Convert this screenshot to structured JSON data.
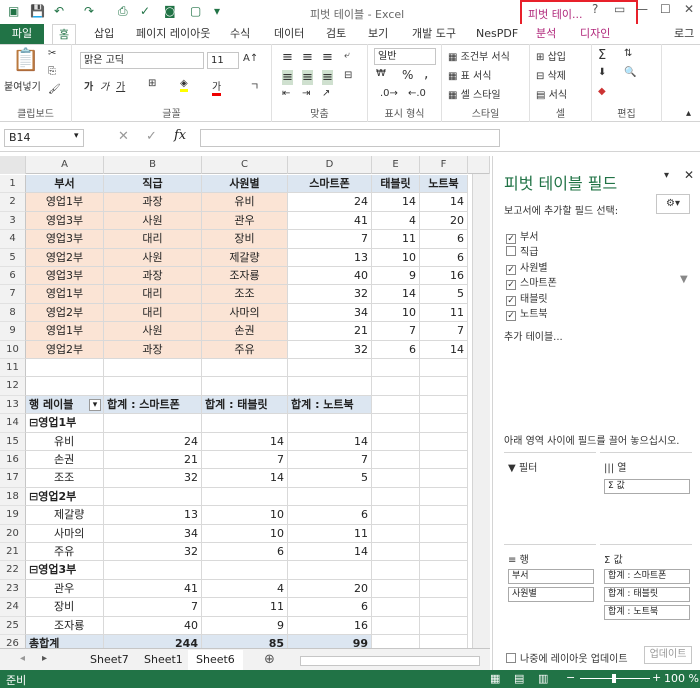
{
  "window": {
    "title": "피벗 테이블 - Excel",
    "context_group": "피벗 테이...",
    "help": "?"
  },
  "qat": {
    "save": "save-icon",
    "undo": "undo-icon",
    "redo": "redo-icon"
  },
  "tabs": {
    "file": "파일",
    "items": [
      "홈",
      "삽입",
      "페이지 레이아웃",
      "수식",
      "데이터",
      "검토",
      "보기",
      "개발 도구",
      "NesPDF"
    ],
    "context": [
      "분석",
      "디자인"
    ],
    "login": "로그"
  },
  "ribbon": {
    "clipboard": {
      "label": "클립보드",
      "paste": "붙여넣기"
    },
    "font": {
      "label": "글꼴",
      "name": "맑은 고딕",
      "size": "11"
    },
    "align": {
      "label": "맞춤"
    },
    "number": {
      "label": "표시 형식",
      "format": "일반",
      "percent": "%",
      "comma": ","
    },
    "styles": {
      "label": "스타일",
      "cond": "조건부 서식",
      "table": "표 서식",
      "cell": "셀 스타일"
    },
    "cells": {
      "label": "셀",
      "insert": "삽입",
      "delete": "삭제",
      "format": "서식"
    },
    "editing": {
      "label": "편집"
    }
  },
  "formula": {
    "namebox": "B14",
    "fx": "fx"
  },
  "columns": [
    "A",
    "B",
    "C",
    "D",
    "E",
    "F"
  ],
  "rows": [
    "1",
    "2",
    "3",
    "4",
    "5",
    "6",
    "7",
    "8",
    "9",
    "10",
    "11",
    "12",
    "13",
    "14",
    "15",
    "16",
    "17",
    "18",
    "19",
    "20",
    "21",
    "22",
    "23",
    "24",
    "25",
    "26"
  ],
  "table": {
    "headers": [
      "부서",
      "직급",
      "사원별",
      "스마트폰",
      "태블릿",
      "노트북"
    ],
    "data": [
      [
        "영업1부",
        "과장",
        "유비",
        "24",
        "14",
        "14"
      ],
      [
        "영업3부",
        "사원",
        "관우",
        "41",
        "4",
        "20"
      ],
      [
        "영업3부",
        "대리",
        "장비",
        "7",
        "11",
        "6"
      ],
      [
        "영업2부",
        "사원",
        "제갈량",
        "13",
        "10",
        "6"
      ],
      [
        "영업3부",
        "과장",
        "조자룡",
        "40",
        "9",
        "16"
      ],
      [
        "영업1부",
        "대리",
        "조조",
        "32",
        "14",
        "5"
      ],
      [
        "영업2부",
        "대리",
        "사마의",
        "34",
        "10",
        "11"
      ],
      [
        "영업1부",
        "사원",
        "손권",
        "21",
        "7",
        "7"
      ],
      [
        "영업2부",
        "과장",
        "주유",
        "32",
        "6",
        "14"
      ]
    ]
  },
  "pivot": {
    "headers": [
      "행 레이블",
      "합계 : 스마트폰",
      "합계 : 태블릿",
      "합계 : 노트북"
    ],
    "rows": [
      {
        "label": "⊟영업1부",
        "group": true,
        "v": [
          "",
          "",
          ""
        ]
      },
      {
        "label": "유비",
        "v": [
          "24",
          "14",
          "14"
        ]
      },
      {
        "label": "손권",
        "v": [
          "21",
          "7",
          "7"
        ]
      },
      {
        "label": "조조",
        "v": [
          "32",
          "14",
          "5"
        ]
      },
      {
        "label": "⊟영업2부",
        "group": true,
        "v": [
          "",
          "",
          ""
        ]
      },
      {
        "label": "제갈량",
        "v": [
          "13",
          "10",
          "6"
        ]
      },
      {
        "label": "사마의",
        "v": [
          "34",
          "10",
          "11"
        ]
      },
      {
        "label": "주유",
        "v": [
          "32",
          "6",
          "14"
        ]
      },
      {
        "label": "⊟영업3부",
        "group": true,
        "v": [
          "",
          "",
          ""
        ]
      },
      {
        "label": "관우",
        "v": [
          "41",
          "4",
          "20"
        ]
      },
      {
        "label": "장비",
        "v": [
          "7",
          "11",
          "6"
        ]
      },
      {
        "label": "조자룡",
        "v": [
          "40",
          "9",
          "16"
        ]
      }
    ],
    "total": {
      "label": "총합계",
      "v": [
        "244",
        "85",
        "99"
      ]
    }
  },
  "sheets": [
    "Sheet7",
    "Sheet1",
    "Sheet6"
  ],
  "status": {
    "ready": "준비",
    "zoom": "100 %"
  },
  "panel": {
    "title": "피벗 테이블 필드",
    "choose": "보고서에 추가할 필드 선택:",
    "fields": [
      {
        "name": "부서",
        "checked": true
      },
      {
        "name": "직급",
        "checked": false
      },
      {
        "name": "사원별",
        "checked": true
      },
      {
        "name": "스마트폰",
        "checked": true
      },
      {
        "name": "태블릿",
        "checked": true
      },
      {
        "name": "노트북",
        "checked": true
      }
    ],
    "more": "추가 테이블...",
    "drag": "아래 영역 사이에 필드를 끌어 놓으십시오.",
    "filter": "필터",
    "columns": "열",
    "rowsArea": "행",
    "values": "값",
    "colItem": "Σ 값",
    "rowItems": [
      "부서",
      "사원별"
    ],
    "valueItems": [
      "합계 : 스마트폰",
      "합계 : 태블릿",
      "합계 : 노트북"
    ],
    "defer": "나중에 레이아웃 업데이트",
    "update": "업데이트"
  }
}
